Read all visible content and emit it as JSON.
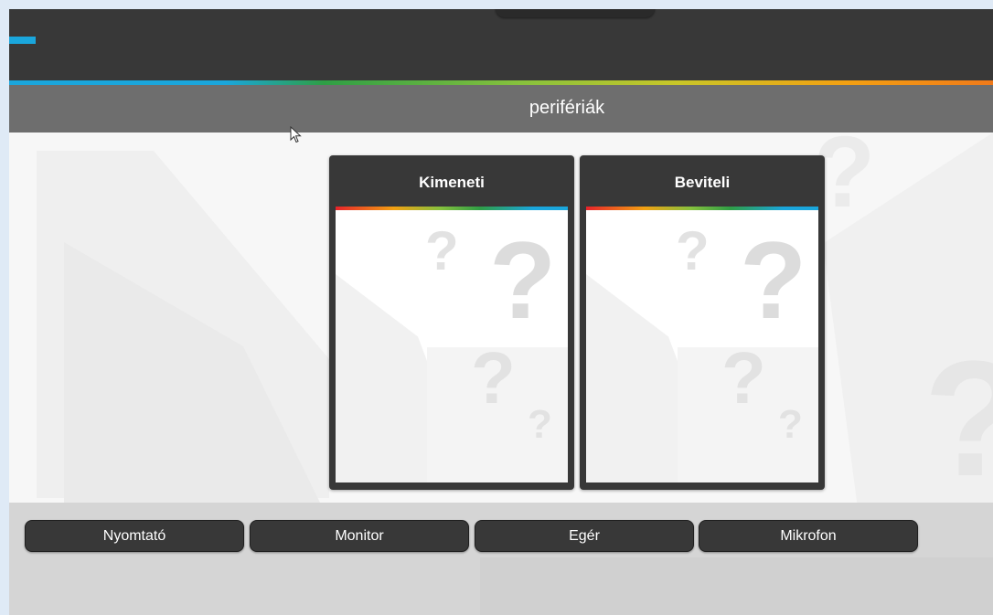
{
  "header": {
    "title": "perifériák"
  },
  "categories": [
    {
      "label": "Kimeneti"
    },
    {
      "label": "Beviteli"
    }
  ],
  "items": [
    {
      "label": "Nyomtató"
    },
    {
      "label": "Monitor"
    },
    {
      "label": "Egér"
    },
    {
      "label": "Mikrofon"
    }
  ],
  "colors": {
    "dark_bar": "#383838",
    "title_bar": "#6e6e6e",
    "accent_blue": "#1aa6dc",
    "tray": "#d5d5d5"
  }
}
